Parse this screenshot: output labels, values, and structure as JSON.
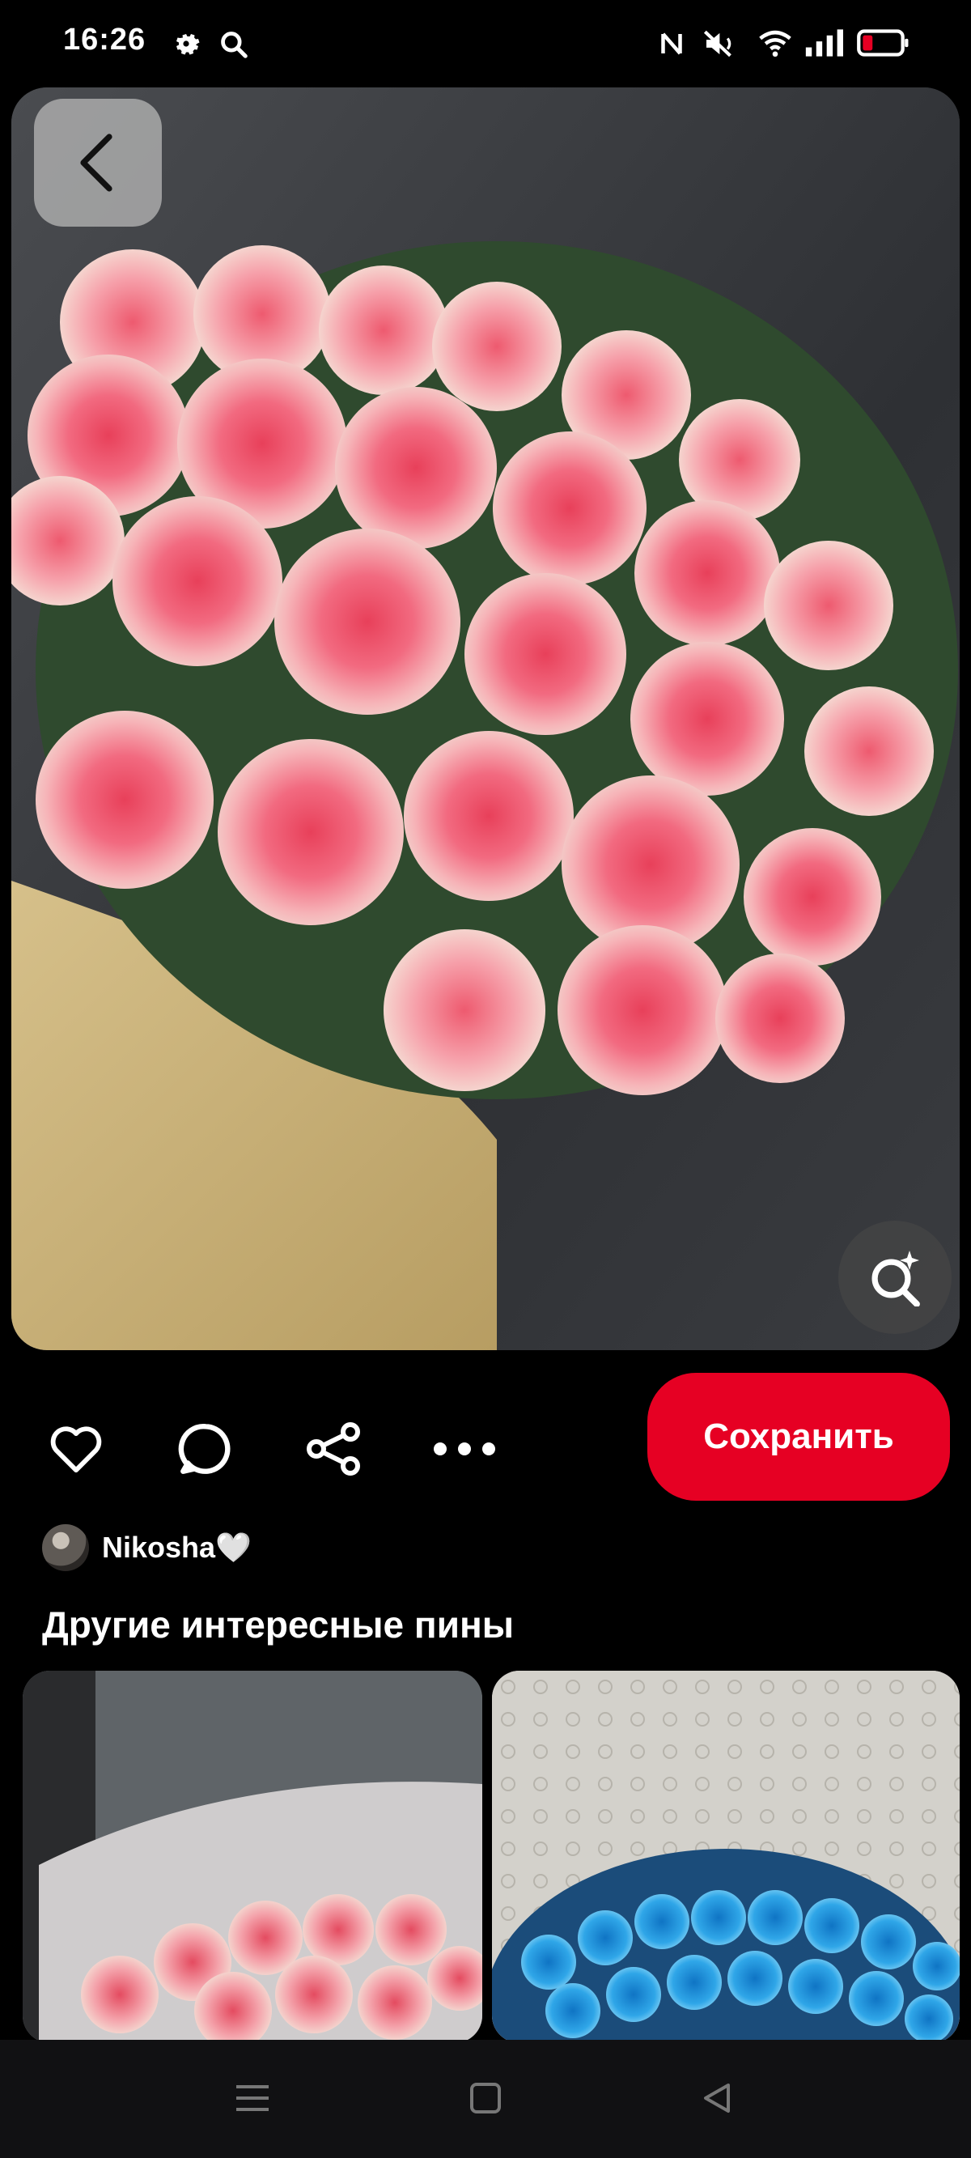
{
  "status_bar": {
    "time": "16:26",
    "icons": [
      "gear-icon",
      "search-icon",
      "nfc-icon",
      "mute-icon",
      "wifi-icon",
      "signal-icon",
      "battery-icon"
    ]
  },
  "pin": {
    "image_description": "bouquet of pink roses",
    "author": "Nikosha🤍"
  },
  "actions": {
    "save_label": "Сохранить",
    "icons": [
      "heart-icon",
      "comment-icon",
      "share-icon",
      "more-icon"
    ]
  },
  "section": {
    "title": "Другие интересные пины"
  },
  "colors": {
    "accent": "#e60023",
    "background": "#000000",
    "text": "#ffffff"
  },
  "nav_bar": {
    "icons": [
      "menu-icon",
      "home-icon",
      "back-icon"
    ]
  }
}
